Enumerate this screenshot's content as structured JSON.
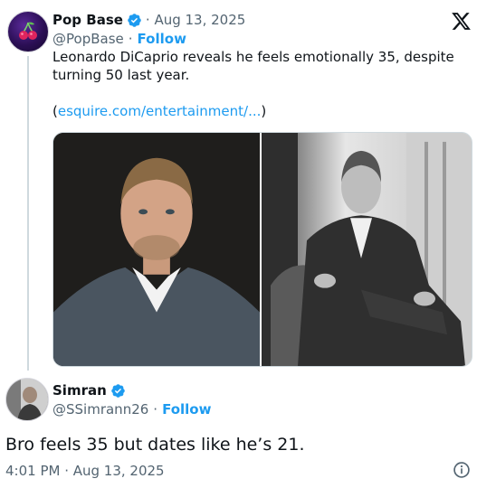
{
  "quoted_tweet": {
    "display_name": "Pop Base",
    "date_meta": "· Aug 13, 2025",
    "handle": "@PopBase",
    "separator": "·",
    "follow_label": "Follow",
    "text": "Leonardo DiCaprio reveals he feels emotionally 35, despite turning 50 last year.",
    "link_open": "(",
    "link_text": "esquire.com/entertainment/...",
    "link_close": ")"
  },
  "reply_tweet": {
    "display_name": "Simran",
    "handle": "@SSimrann26",
    "separator": "·",
    "follow_label": "Follow",
    "text": "Bro feels 35 but dates like he’s 21.",
    "timestamp": "4:01 PM · Aug 13, 2025"
  },
  "colors": {
    "accent": "#1d9bf0",
    "secondary_text": "#536471",
    "primary_text": "#0f1419",
    "thread_line": "#cfd9de"
  },
  "icons": {
    "brand": "x-logo-icon",
    "verified": "verified-badge-icon",
    "info": "info-icon"
  }
}
